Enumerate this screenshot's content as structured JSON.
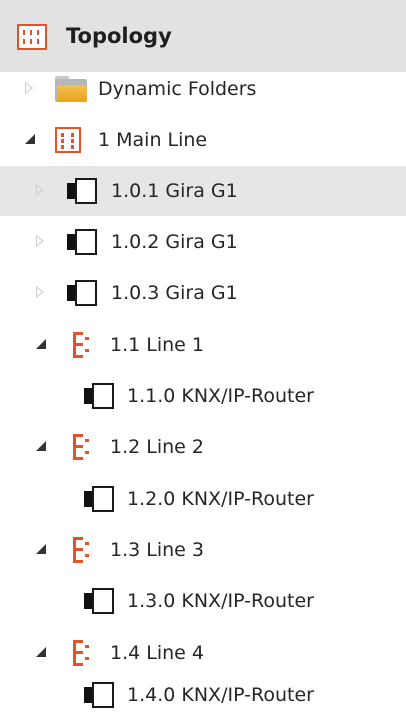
{
  "panel": {
    "title": "Topology",
    "icon": "topology-icon",
    "accent_color": "#e2532a"
  },
  "tree": {
    "items": [
      {
        "label": "Dynamic Folders",
        "icon": "folder-icon",
        "expander": "collapsed",
        "selected": false
      },
      {
        "label": "1 Main Line",
        "icon": "area-icon",
        "expander": "expanded",
        "selected": false
      },
      {
        "label": "1.0.1 Gira G1",
        "icon": "device-icon",
        "expander": "collapsed",
        "selected": true
      },
      {
        "label": "1.0.2 Gira G1",
        "icon": "device-icon",
        "expander": "collapsed",
        "selected": false
      },
      {
        "label": "1.0.3 Gira G1",
        "icon": "device-icon",
        "expander": "collapsed",
        "selected": false
      },
      {
        "label": "1.1 Line 1",
        "icon": "line-icon",
        "expander": "expanded",
        "selected": false
      },
      {
        "label": "1.1.0 KNX/IP-Router",
        "icon": "device-icon",
        "expander": "none",
        "selected": false
      },
      {
        "label": "1.2 Line 2",
        "icon": "line-icon",
        "expander": "expanded",
        "selected": false
      },
      {
        "label": "1.2.0 KNX/IP-Router",
        "icon": "device-icon",
        "expander": "none",
        "selected": false
      },
      {
        "label": "1.3 Line 3",
        "icon": "line-icon",
        "expander": "expanded",
        "selected": false
      },
      {
        "label": "1.3.0 KNX/IP-Router",
        "icon": "device-icon",
        "expander": "none",
        "selected": false
      },
      {
        "label": "1.4 Line 4",
        "icon": "line-icon",
        "expander": "expanded",
        "selected": false
      },
      {
        "label": "1.4.0 KNX/IP-Router",
        "icon": "device-icon",
        "expander": "none",
        "selected": false
      }
    ]
  }
}
